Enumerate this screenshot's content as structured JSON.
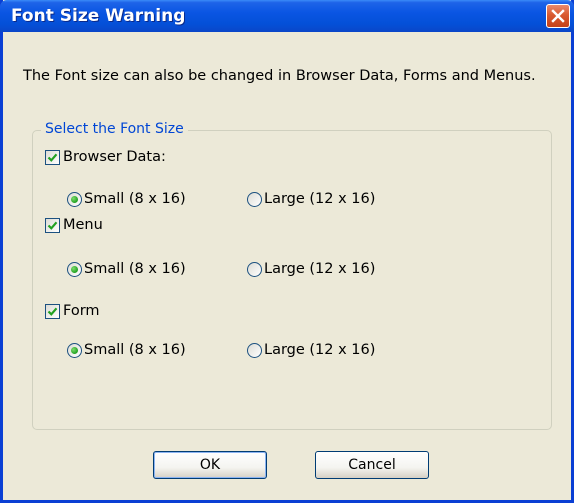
{
  "window": {
    "title": "Font Size Warning"
  },
  "message": "The Font size can also be changed in Browser Data, Forms and Menus.",
  "group": {
    "legend": "Select the Font Size",
    "sections": [
      {
        "label": "Browser Data:",
        "checked": true,
        "options": [
          {
            "label": "Small (8 x 16)",
            "selected": true
          },
          {
            "label": "Large (12 x 16)",
            "selected": false
          }
        ]
      },
      {
        "label": "Menu",
        "checked": true,
        "options": [
          {
            "label": "Small (8 x 16)",
            "selected": true
          },
          {
            "label": "Large (12 x 16)",
            "selected": false
          }
        ]
      },
      {
        "label": "Form",
        "checked": true,
        "options": [
          {
            "label": "Small (8 x 16)",
            "selected": true
          },
          {
            "label": "Large (12 x 16)",
            "selected": false
          }
        ]
      }
    ]
  },
  "buttons": {
    "ok": "OK",
    "cancel": "Cancel"
  },
  "colors": {
    "titlebar": "#0a55e3",
    "dialog_bg": "#ece9d8",
    "legend_text": "#0046d5",
    "check_mark": "#21a121",
    "close_button": "#d95a30"
  },
  "icons": {
    "close": "close-x-icon",
    "check": "check-icon",
    "radio_selected": "radio-dot-icon"
  }
}
